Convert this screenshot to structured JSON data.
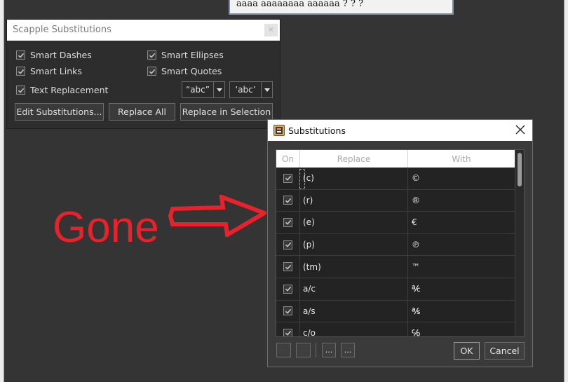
{
  "canvas_note": {
    "text": "aaaa aaaaaaaa aaaaaa ? ? ?"
  },
  "panel": {
    "title": "Scapple Substitutions",
    "close_label": "×",
    "checks": {
      "smart_dashes": "Smart Dashes",
      "smart_ellipses": "Smart Ellipses",
      "smart_links": "Smart Links",
      "smart_quotes": "Smart Quotes",
      "text_replacement": "Text Replacement"
    },
    "double_quotes_combo": "“abc”",
    "single_quotes_combo": "‘abc’",
    "buttons": {
      "edit": "Edit Substitutions...",
      "replace_all": "Replace All",
      "replace_selection": "Replace in Selection"
    }
  },
  "annotation": {
    "text": "Gone",
    "color": "#e8222b"
  },
  "dialog": {
    "title": "Substitutions",
    "columns": {
      "on": "On",
      "replace": "Replace",
      "with": "With"
    },
    "rows": [
      {
        "replace": "(c)",
        "with": "©"
      },
      {
        "replace": "(r)",
        "with": "®"
      },
      {
        "replace": "(e)",
        "with": "€"
      },
      {
        "replace": "(p)",
        "with": "℗"
      },
      {
        "replace": "(tm)",
        "with": "™"
      },
      {
        "replace": "a/c",
        "with": "℀"
      },
      {
        "replace": "a/s",
        "with": "℁"
      },
      {
        "replace": "c/o",
        "with": "℅"
      }
    ],
    "small_buttons": {
      "more1": "...",
      "more2": "..."
    },
    "ok": "OK",
    "cancel": "Cancel"
  }
}
